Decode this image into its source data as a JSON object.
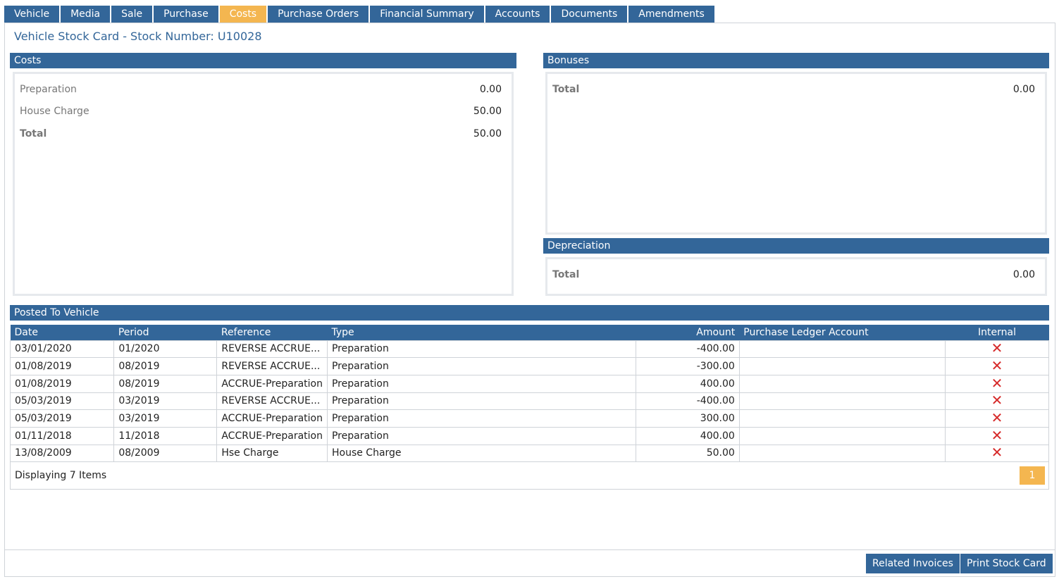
{
  "tabs": [
    {
      "label": "Vehicle"
    },
    {
      "label": "Media"
    },
    {
      "label": "Sale"
    },
    {
      "label": "Purchase"
    },
    {
      "label": "Costs"
    },
    {
      "label": "Purchase Orders"
    },
    {
      "label": "Financial Summary"
    },
    {
      "label": "Accounts"
    },
    {
      "label": "Documents"
    },
    {
      "label": "Amendments"
    }
  ],
  "active_tab": "Costs",
  "page_title": "Vehicle Stock Card - Stock Number: U10028",
  "costs": {
    "title": "Costs",
    "rows": [
      {
        "label": "Preparation",
        "value": "0.00"
      },
      {
        "label": "House Charge",
        "value": "50.00"
      },
      {
        "label": "Total",
        "value": "50.00"
      }
    ]
  },
  "bonuses": {
    "title": "Bonuses",
    "total_label": "Total",
    "total_value": "0.00"
  },
  "depreciation": {
    "title": "Depreciation",
    "total_label": "Total",
    "total_value": "0.00"
  },
  "posted": {
    "title": "Posted To Vehicle",
    "columns": [
      "Date",
      "Period",
      "Reference",
      "Type",
      "Amount",
      "Purchase Ledger Account",
      "Internal"
    ],
    "rows": [
      [
        "03/01/2020",
        "01/2020",
        "REVERSE ACCRUE...",
        "Preparation",
        "-400.00",
        "",
        "x"
      ],
      [
        "01/08/2019",
        "08/2019",
        "REVERSE ACCRUE...",
        "Preparation",
        "-300.00",
        "",
        "x"
      ],
      [
        "01/08/2019",
        "08/2019",
        "ACCRUE-Preparation",
        "Preparation",
        "400.00",
        "",
        "x"
      ],
      [
        "05/03/2019",
        "03/2019",
        "REVERSE ACCRUE...",
        "Preparation",
        "-400.00",
        "",
        "x"
      ],
      [
        "05/03/2019",
        "03/2019",
        "ACCRUE-Preparation",
        "Preparation",
        "300.00",
        "",
        "x"
      ],
      [
        "01/11/2018",
        "11/2018",
        "ACCRUE-Preparation",
        "Preparation",
        "400.00",
        "",
        "x"
      ],
      [
        "13/08/2009",
        "08/2009",
        "Hse Charge",
        "House Charge",
        "50.00",
        "",
        "x"
      ]
    ],
    "display_count": "Displaying 7 Items",
    "page": "1"
  },
  "buttons": {
    "related_invoices": "Related Invoices",
    "print_stock_card": "Print Stock Card"
  },
  "colors": {
    "header_blue": "#336699",
    "accent_orange": "#f4b650",
    "delete_red": "#d62a2a"
  },
  "icons": {
    "internal": "close-icon"
  }
}
